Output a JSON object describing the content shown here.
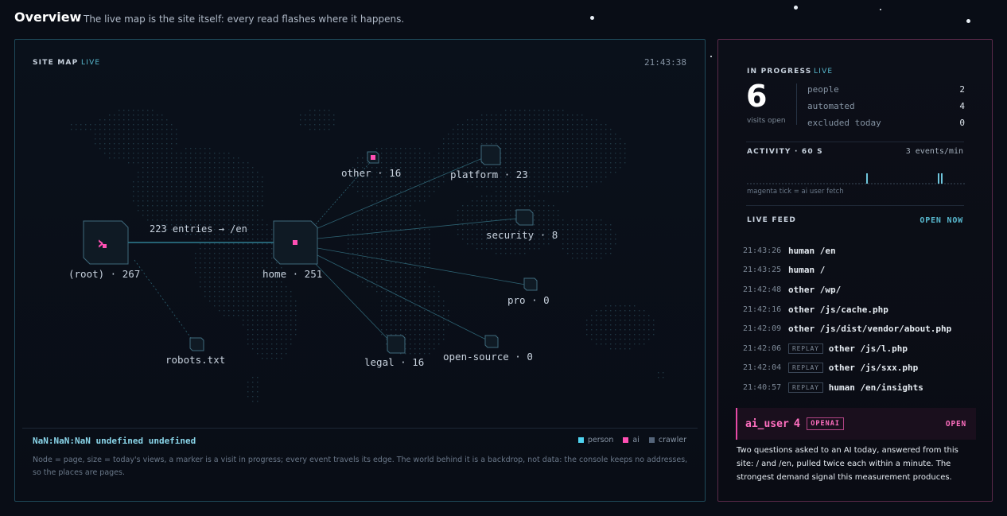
{
  "header": {
    "title": "Overview",
    "subtitle": "The live map is the site itself: every read flashes where it happens."
  },
  "map": {
    "label": "SITE MAP",
    "live": "LIVE",
    "time": "21:43:38",
    "edge_label": "223 entries → /en",
    "nodes": {
      "root": "(root) · 267",
      "home": "home · 251",
      "other": "other · 16",
      "platform": "platform · 23",
      "security": "security · 8",
      "pro": "pro · 0",
      "legal": "legal · 16",
      "open_source": "open-source · 0",
      "robots": "robots.txt"
    },
    "status": "NaN:NaN:NaN undefined undefined",
    "legend": [
      {
        "label": "person",
        "color": "#4fd3f0"
      },
      {
        "label": "ai",
        "color": "#ff4fb3"
      },
      {
        "label": "crawler",
        "color": "#55657a"
      }
    ],
    "note": "Node = page, size = today's views, a marker is a visit in progress; every event travels its edge. The world behind it is a backdrop, not data: the console keeps no addresses, so the places are pages."
  },
  "progress": {
    "label": "IN PROGRESS",
    "live": "LIVE",
    "count": "6",
    "count_label": "visits open",
    "stats": [
      {
        "key": "people",
        "value": "2"
      },
      {
        "key": "automated",
        "value": "4"
      },
      {
        "key": "excluded today",
        "value": "0"
      }
    ]
  },
  "activity": {
    "label": "ACTIVITY · 60 S",
    "rate": "3 events/min",
    "note": "magenta tick = ai  user fetch"
  },
  "feed": {
    "label": "LIVE FEED",
    "open_now": "OPEN NOW",
    "items": [
      {
        "time": "21:43:26",
        "replay": "",
        "text": "human /en"
      },
      {
        "time": "21:43:25",
        "replay": "",
        "text": "human /"
      },
      {
        "time": "21:42:48",
        "replay": "",
        "text": "other /wp/"
      },
      {
        "time": "21:42:16",
        "replay": "",
        "text": "other /js/cache.php"
      },
      {
        "time": "21:42:09",
        "replay": "",
        "text": "other /js/dist/vendor/about.php"
      },
      {
        "time": "21:42:06",
        "replay": "REPLAY",
        "text": "other /js/l.php"
      },
      {
        "time": "21:42:04",
        "replay": "REPLAY",
        "text": "other /js/sxx.php"
      },
      {
        "time": "21:40:57",
        "replay": "REPLAY",
        "text": "human /en/insights"
      }
    ]
  },
  "ai_card": {
    "name": "ai_user",
    "count": "4",
    "badge": "OPENAI",
    "open": "OPEN",
    "description": "Two questions asked to an AI today, answered from this site: / and /en, pulled twice each within a minute. The strongest demand signal this measurement produces."
  }
}
